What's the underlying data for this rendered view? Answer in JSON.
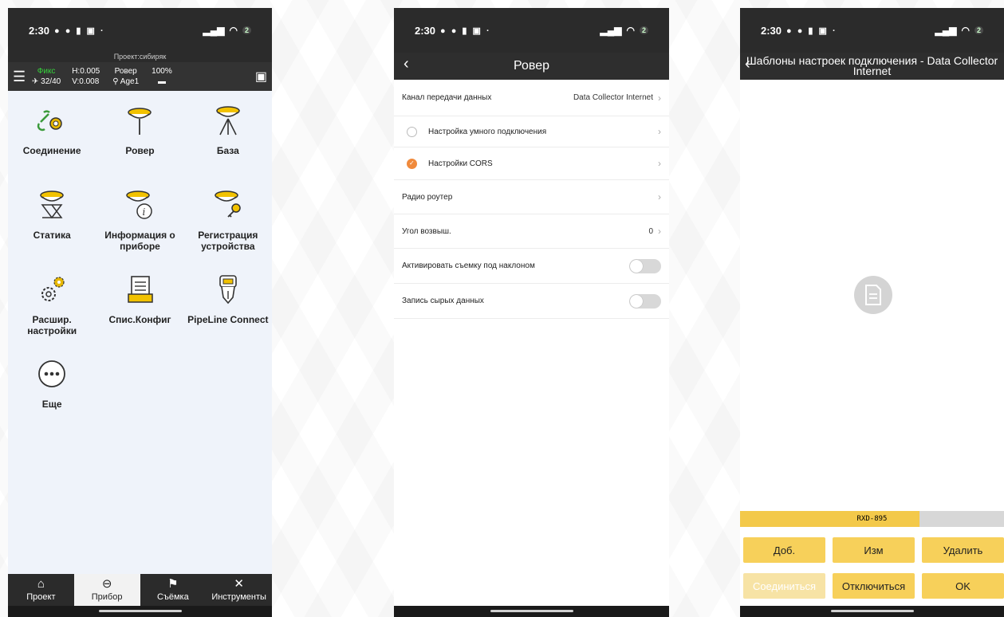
{
  "statusbar": {
    "time": "2:30",
    "battery": "2"
  },
  "phone1": {
    "project": "Проект:сибиряк",
    "status": {
      "fix": "Фикс",
      "sats": "32/40",
      "h": "H:0.005",
      "v": "V:0.008",
      "mode": "Ровер",
      "age": "Age1",
      "battery_pct": "100%"
    },
    "tiles": [
      {
        "label": "Соединение",
        "icon": "link-gear-icon"
      },
      {
        "label": "Ровер",
        "icon": "rover-receiver-icon"
      },
      {
        "label": "База",
        "icon": "base-tripod-icon"
      },
      {
        "label": "Статика",
        "icon": "static-receiver-icon"
      },
      {
        "label": "Информация о приборе",
        "icon": "device-info-icon"
      },
      {
        "label": "Регистрация устройства",
        "icon": "device-register-key-icon"
      },
      {
        "label": "Расшир. настройки",
        "icon": "advanced-settings-gear-icon"
      },
      {
        "label": "Спис.Конфиг",
        "icon": "config-list-icon"
      },
      {
        "label": "PipeLine Connect",
        "icon": "pipeline-connect-icon"
      },
      {
        "label": "Еще",
        "icon": "more-dots-icon"
      }
    ],
    "bottom_nav": [
      {
        "label": "Проект",
        "icon": "home-icon"
      },
      {
        "label": "Прибор",
        "icon": "receiver-icon"
      },
      {
        "label": "Съёмка",
        "icon": "survey-icon"
      },
      {
        "label": "Инструменты",
        "icon": "tools-icon"
      }
    ],
    "active_tab": "Прибор"
  },
  "phone2": {
    "title": "Ровер",
    "rows": {
      "channel_label": "Канал передачи данных",
      "channel_value": "Data Collector Internet",
      "smart_label": "Настройка умного подключения",
      "cors_label": "Настройки CORS",
      "radio_label": "Радио роутер",
      "angle_label": "Угол возвыш.",
      "angle_value": "0",
      "tilt_label": "Активировать съемку под наклоном",
      "raw_label": "Запись сырых данных"
    },
    "selected_option": "Настройки CORS",
    "toggles": {
      "tilt": false,
      "raw": false
    }
  },
  "phone3": {
    "title": "Шаблоны настроек подключения - Data Collector Internet",
    "device": "RXD-895",
    "buttons": {
      "add": "Доб.",
      "edit": "Изм",
      "delete": "Удалить",
      "connect": "Соединиться",
      "disconnect": "Отключиться",
      "ok": "OK"
    }
  },
  "colors": {
    "accent_yellow": "#f7d05a",
    "accent_orange": "#f08a3c",
    "fix_green": "#36d13b",
    "header_dark": "#2b2b2b"
  }
}
